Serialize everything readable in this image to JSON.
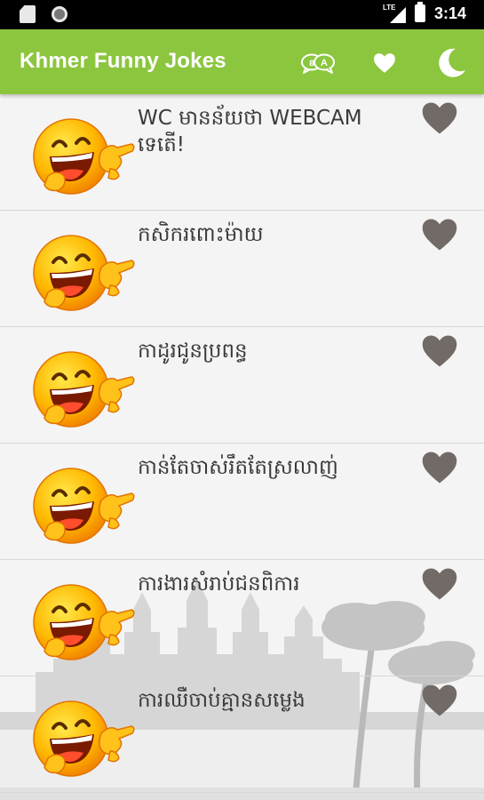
{
  "status_bar": {
    "network": "LTE",
    "time": "3:14"
  },
  "app_bar": {
    "title": "Khmer Funny Jokes",
    "actions": [
      {
        "icon": "translate-icon"
      },
      {
        "icon": "heart-icon"
      },
      {
        "icon": "moon-icon"
      }
    ]
  },
  "colors": {
    "app_bar": "#8cc63f",
    "heart": "#716a66",
    "status_bar": "#000000",
    "text": "#3a3a3a"
  },
  "jokes": [
    {
      "title": "WC មានន័យថា WEBCAM ទេតើ!",
      "favorite": false
    },
    {
      "title": "កសិករពោះម៉ាយ",
      "favorite": false
    },
    {
      "title": "កាដូរជូនប្រពន្ធ",
      "favorite": false
    },
    {
      "title": "កាន់តែចាស់រឹតតែស្រលាញ់",
      "favorite": false
    },
    {
      "title": "ការងារសំរាប់ជនពិការ",
      "favorite": false
    },
    {
      "title": "ការឈឺចាប់គ្មានសម្លេង",
      "favorite": false
    }
  ]
}
